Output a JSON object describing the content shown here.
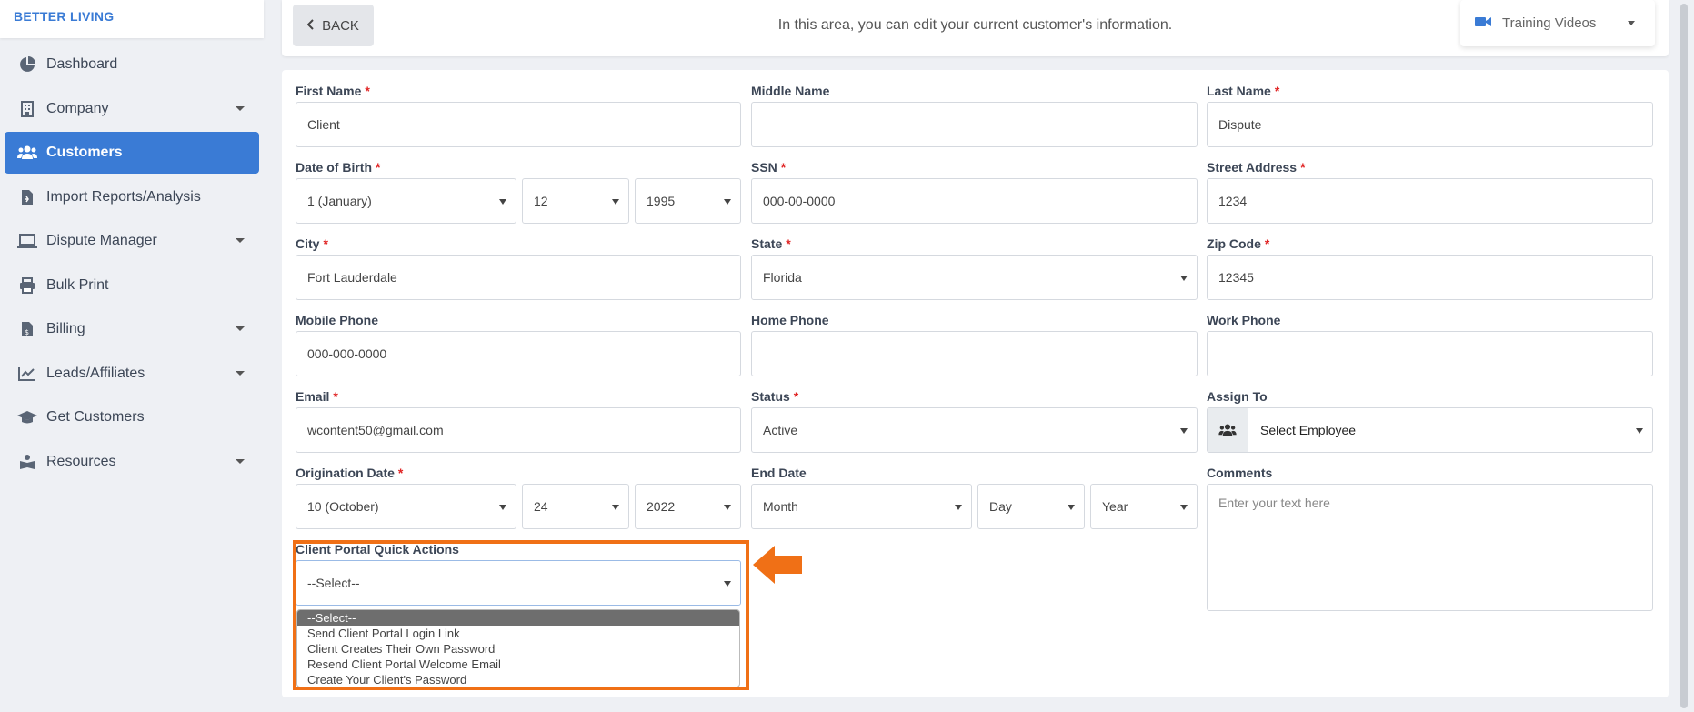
{
  "brand": "BETTER LIVING",
  "sidebar": {
    "items": [
      {
        "label": "Dashboard",
        "icon": "pie-chart-icon",
        "has_caret": false,
        "active": false
      },
      {
        "label": "Company",
        "icon": "building-icon",
        "has_caret": true,
        "active": false
      },
      {
        "label": "Customers",
        "icon": "users-icon",
        "has_caret": false,
        "active": true
      },
      {
        "label": "Import Reports/Analysis",
        "icon": "file-import-icon",
        "has_caret": false,
        "active": false
      },
      {
        "label": "Dispute Manager",
        "icon": "laptop-icon",
        "has_caret": true,
        "active": false
      },
      {
        "label": "Bulk Print",
        "icon": "printer-icon",
        "has_caret": false,
        "active": false
      },
      {
        "label": "Billing",
        "icon": "invoice-icon",
        "has_caret": true,
        "active": false
      },
      {
        "label": "Leads/Affiliates",
        "icon": "chart-line-icon",
        "has_caret": true,
        "active": false
      },
      {
        "label": "Get Customers",
        "icon": "graduation-cap-icon",
        "has_caret": false,
        "active": false
      },
      {
        "label": "Resources",
        "icon": "book-reader-icon",
        "has_caret": true,
        "active": false
      }
    ]
  },
  "header": {
    "back_label": "BACK",
    "intro": "In this area, you can edit your current customer's information.",
    "training_label": "Training Videos"
  },
  "form": {
    "first_name": {
      "label": "First Name",
      "value": "Client"
    },
    "middle_name": {
      "label": "Middle Name",
      "value": ""
    },
    "last_name": {
      "label": "Last Name",
      "value": "Dispute"
    },
    "dob": {
      "label": "Date of Birth",
      "month": "1 (January)",
      "day": "12",
      "year": "1995"
    },
    "ssn": {
      "label": "SSN",
      "value": "000-00-0000"
    },
    "street": {
      "label": "Street Address",
      "value": "1234"
    },
    "city": {
      "label": "City",
      "value": "Fort Lauderdale"
    },
    "state": {
      "label": "State",
      "value": "Florida"
    },
    "zip": {
      "label": "Zip Code",
      "value": "12345"
    },
    "mobile": {
      "label": "Mobile Phone",
      "value": "000-000-0000"
    },
    "home": {
      "label": "Home Phone",
      "value": ""
    },
    "work": {
      "label": "Work Phone",
      "value": ""
    },
    "email": {
      "label": "Email",
      "value": "wcontent50@gmail.com"
    },
    "status": {
      "label": "Status",
      "value": "Active"
    },
    "assign": {
      "label": "Assign To",
      "value": "Select Employee"
    },
    "orig": {
      "label": "Origination Date",
      "month": "10 (October)",
      "day": "24",
      "year": "2022"
    },
    "end": {
      "label": "End Date",
      "month": "Month",
      "day": "Day",
      "year": "Year"
    },
    "comments": {
      "label": "Comments",
      "placeholder": "Enter your text here"
    },
    "quick": {
      "label": "Client Portal Quick Actions",
      "value": "--Select--",
      "options": [
        "--Select--",
        "Send Client Portal Login Link",
        "Client Creates Their Own Password",
        "Resend Client Portal Welcome Email",
        "Create Your Client's Password"
      ]
    }
  },
  "colors": {
    "accent": "#3a7bd5",
    "highlight": "#f07016",
    "required": "#e02424"
  }
}
